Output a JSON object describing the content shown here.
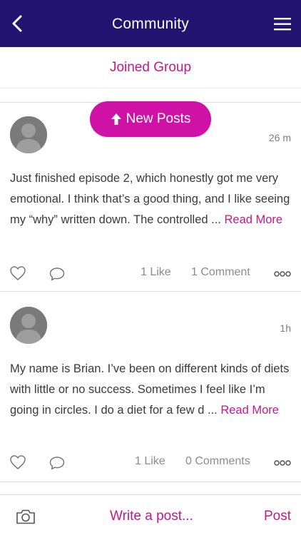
{
  "header": {
    "title": "Community",
    "back_icon": "chevron-left-icon",
    "menu_icon": "hamburger-menu-icon"
  },
  "tabs": {
    "joined_group": "Joined Group"
  },
  "new_posts_button": {
    "label": "New Posts",
    "icon": "arrow-up-icon"
  },
  "posts": [
    {
      "time": "26 m",
      "text": "Just finished episode 2, which honestly got me very emotional. I think that’s a good thing, and I like seeing my “why” written down. The controlled ...",
      "read_more": "Read More",
      "likes": "1 Like",
      "comments": "1 Comment"
    },
    {
      "time": "1h",
      "text": "My name is Brian. I’ve been on different kinds of diets with little or no success. Sometimes I feel like I’m going in circles. I do a diet for a few d ...",
      "read_more": "Read More",
      "likes": "1 Like",
      "comments": "0 Comments"
    }
  ],
  "composer": {
    "placeholder": "Write a post...",
    "post_label": "Post",
    "camera_icon": "camera-icon"
  },
  "colors": {
    "header_bg": "#221470",
    "accent": "#c2188a",
    "pill": "#cf12a5"
  }
}
